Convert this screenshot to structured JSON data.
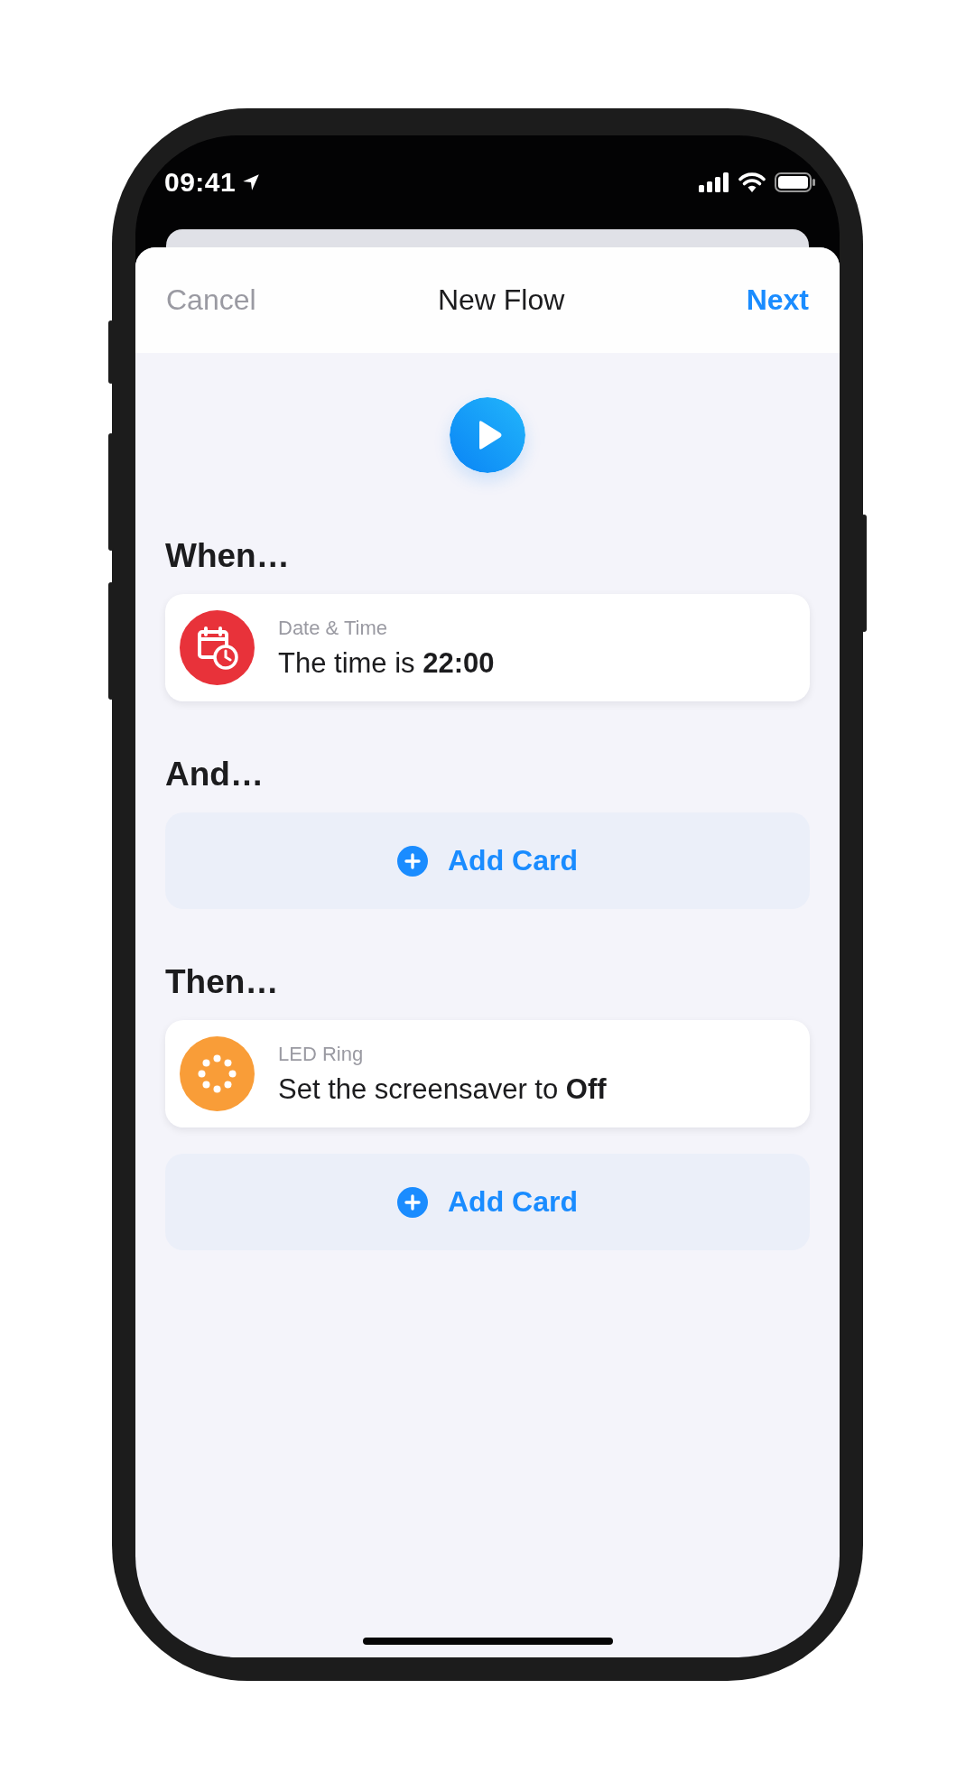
{
  "status_bar": {
    "time": "09:41"
  },
  "nav": {
    "cancel": "Cancel",
    "title": "New Flow",
    "next": "Next"
  },
  "sections": [
    {
      "heading": "When…",
      "items": [
        {
          "kind": "rule",
          "color": "#e8323a",
          "category": "Date & Time",
          "text": "The time is **22:00**"
        }
      ]
    },
    {
      "heading": "And…",
      "items": [
        {
          "kind": "add",
          "label": "Add Card"
        }
      ]
    },
    {
      "heading": "Then…",
      "items": [
        {
          "kind": "rule",
          "color": "#f99d38",
          "category": "LED Ring",
          "text": "Set the screensaver to **Off**"
        },
        {
          "kind": "add",
          "label": "Add Card"
        }
      ]
    }
  ]
}
